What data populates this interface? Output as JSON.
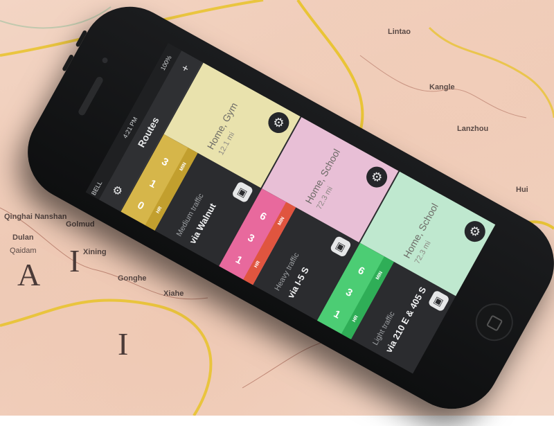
{
  "status": {
    "carrier": "BELL",
    "time": "4:21 PM",
    "battery": "100%"
  },
  "nav": {
    "title": "Routes",
    "settings_icon": "gear-icon",
    "add_icon": "plus-icon"
  },
  "routes": [
    {
      "destination": "Home, Gym",
      "distance": "12.1 mi",
      "traffic": "Medium traffic",
      "via": "via Walnut",
      "digits": [
        "0",
        "1",
        "3"
      ],
      "hr_label": "HR",
      "min_label": "MIN",
      "color_top": "#e9e2ad",
      "color_time": "#d6b64a",
      "color_time_dark": "#c29f2e"
    },
    {
      "destination": "Home, School",
      "distance": "72.3 mi",
      "traffic": "Heavy traffic",
      "via": "via I-5 S",
      "digits": [
        "1",
        "3",
        "6"
      ],
      "hr_label": "HR",
      "min_label": "MIN",
      "color_top": "#e8bfd6",
      "color_time": "#e8699d",
      "color_time_dark": "#e0553f"
    },
    {
      "destination": "Home, School",
      "distance": "72.3 mi",
      "traffic": "Light traffic",
      "via": "via 210 E & 405 S",
      "digits": [
        "1",
        "3",
        "6"
      ],
      "hr_label": "HR",
      "min_label": "MIN",
      "color_top": "#bfe8cf",
      "color_time": "#4ccd74",
      "color_time_dark": "#2fae57"
    }
  ],
  "map_labels": [
    "Dulan",
    "Qaidam",
    "Golmud",
    "Qinghai Nanshan",
    "Xining",
    "Gonghe",
    "Lanzhou",
    "Hui",
    "Xiahe",
    "Kangle",
    "Lintao"
  ],
  "map_big_letters": [
    "A",
    "I",
    "I"
  ]
}
